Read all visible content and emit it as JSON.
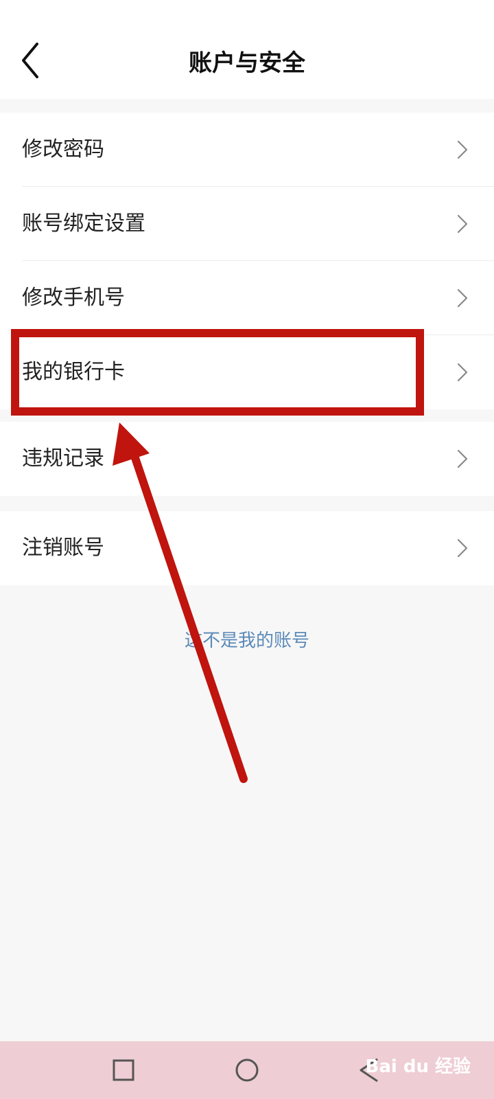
{
  "header": {
    "title": "账户与安全"
  },
  "groups": [
    {
      "items": [
        {
          "label": "修改密码"
        },
        {
          "label": "账号绑定设置"
        },
        {
          "label": "修改手机号"
        },
        {
          "label": "我的银行卡"
        }
      ]
    },
    {
      "items": [
        {
          "label": "违规记录"
        }
      ]
    },
    {
      "items": [
        {
          "label": "注销账号"
        }
      ]
    }
  ],
  "footer": {
    "not_my_account": "这不是我的账号"
  },
  "annotation": {
    "color": "#c0140e"
  },
  "watermark": {
    "text": "Bai du 经验"
  }
}
